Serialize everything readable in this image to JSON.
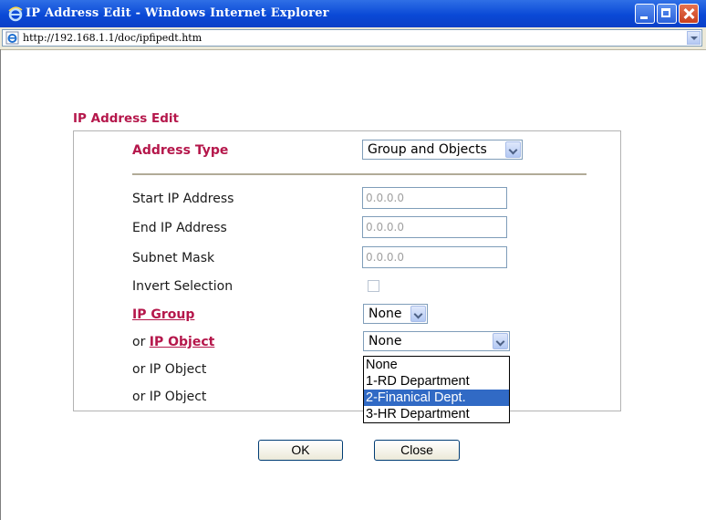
{
  "window": {
    "title": "IP Address Edit - Windows Internet Explorer",
    "url": "http://192.168.1.1/doc/ipfipedt.htm"
  },
  "form": {
    "section_title": "IP Address Edit",
    "address_type": {
      "label": "Address Type",
      "value": "Group and Objects"
    },
    "start_ip": {
      "label": "Start IP Address",
      "value": "0.0.0.0"
    },
    "end_ip": {
      "label": "End IP Address",
      "value": "0.0.0.0"
    },
    "subnet_mask": {
      "label": "Subnet Mask",
      "value": "0.0.0.0"
    },
    "invert_selection": {
      "label": "Invert Selection",
      "checked": false
    },
    "ip_group": {
      "label": "IP Group",
      "value": "None"
    },
    "ip_object_1": {
      "prefix": "or ",
      "label": "IP Object",
      "value": "None"
    },
    "ip_object_2": {
      "label": "or IP Object"
    },
    "ip_object_3": {
      "label": "or IP Object"
    },
    "dropdown_options": [
      "None",
      "1-RD Department",
      "2-Finanical Dept.",
      "3-HR Department"
    ],
    "dropdown_selected_index": 2
  },
  "buttons": {
    "ok": "OK",
    "close": "Close"
  },
  "colors": {
    "accent": "#b5174b",
    "selection": "#316ac5",
    "titlebar": "#0a49d6"
  }
}
